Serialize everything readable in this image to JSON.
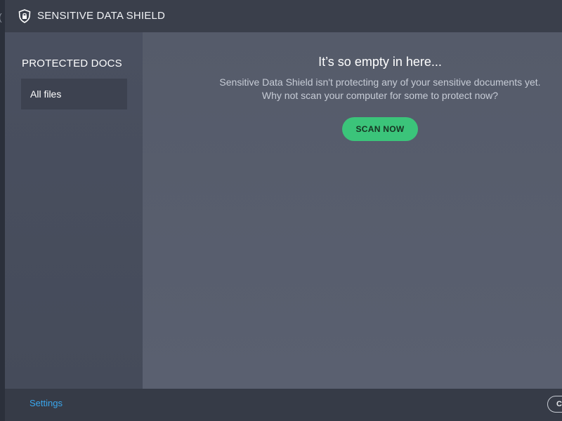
{
  "app": {
    "title": "SENSITIVE DATA SHIELD",
    "icon": "shield-icon"
  },
  "sidebar": {
    "heading": "PROTECTED DOCS",
    "items": [
      {
        "label": "All files",
        "selected": true
      }
    ]
  },
  "main": {
    "empty_title": "It’s so empty in here...",
    "empty_line1": "Sensitive Data Shield isn't protecting any of your sensitive documents yet.",
    "empty_line2": "Why not scan your computer for some to protect now?",
    "scan_button": "SCAN NOW"
  },
  "footer": {
    "settings": "Settings",
    "close_button": "C"
  },
  "colors": {
    "accent_green": "#3bc47a",
    "link_blue": "#3aa7ee"
  }
}
